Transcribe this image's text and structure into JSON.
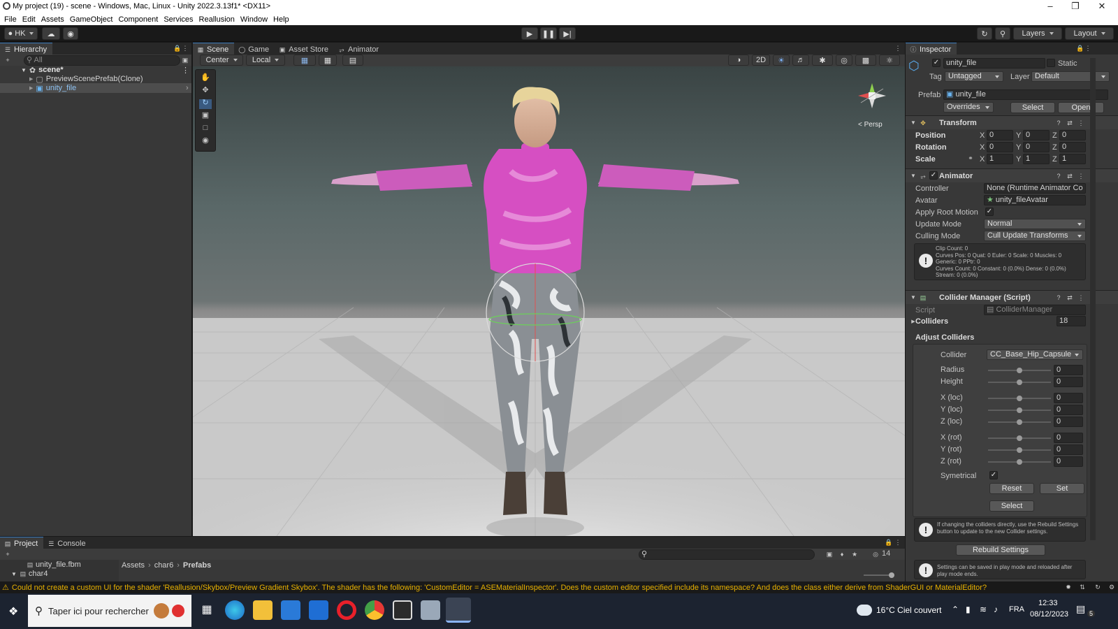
{
  "window": {
    "title": "My project (19) - scene - Windows, Mac, Linux - Unity 2022.3.13f1* <DX11>"
  },
  "menu": [
    "File",
    "Edit",
    "Assets",
    "GameObject",
    "Component",
    "Services",
    "Reallusion",
    "Window",
    "Help"
  ],
  "toolbar": {
    "account": "HK",
    "layers": "Layers",
    "layout": "Layout"
  },
  "hierarchy": {
    "tab": "Hierarchy",
    "search_placeholder": "All",
    "items": [
      {
        "label": "scene*"
      },
      {
        "label": "PreviewScenePrefab(Clone)"
      },
      {
        "label": "unity_file"
      }
    ]
  },
  "scene_view": {
    "tabs": [
      "Scene",
      "Game",
      "Asset Store",
      "Animator"
    ],
    "pivot": "Center",
    "space": "Local",
    "mode_2d": "2D",
    "projection": "< Persp"
  },
  "inspector": {
    "tab": "Inspector",
    "object_name": "unity_file",
    "static_label": "Static",
    "tag_label": "Tag",
    "tag_value": "Untagged",
    "layer_label": "Layer",
    "layer_value": "Default",
    "prefab_label": "Prefab",
    "prefab_value": "unity_file",
    "overrides": "Overrides",
    "select": "Select",
    "open": "Open",
    "transform": {
      "title": "Transform",
      "rows": [
        {
          "label": "Position",
          "x": "0",
          "y": "0",
          "z": "0"
        },
        {
          "label": "Rotation",
          "x": "0",
          "y": "0",
          "z": "0"
        },
        {
          "label": "Scale",
          "x": "1",
          "y": "1",
          "z": "1"
        }
      ]
    },
    "animator": {
      "title": "Animator",
      "controller_label": "Controller",
      "controller_value": "None (Runtime Animator Co",
      "avatar_label": "Avatar",
      "avatar_value": "unity_fileAvatar",
      "apply_root_motion": "Apply Root Motion",
      "update_mode_label": "Update Mode",
      "update_mode_value": "Normal",
      "culling_mode_label": "Culling Mode",
      "culling_mode_value": "Cull Update Transforms",
      "info": [
        "Clip Count: 0",
        "Curves Pos: 0 Quat: 0 Euler: 0 Scale: 0 Muscles: 0",
        "Generic: 0 PPtr: 0",
        "Curves Count: 0 Constant: 0 (0.0%) Dense: 0 (0.0%)",
        "Stream: 0 (0.0%)"
      ]
    },
    "collider_manager": {
      "title": "Collider Manager (Script)",
      "script_label": "Script",
      "script_value": "ColliderManager",
      "colliders_label": "Colliders",
      "colliders_value": "18",
      "adjust_label": "Adjust Colliders",
      "collider_label": "Collider",
      "collider_value": "CC_Base_Hip_Capsule",
      "sliders": [
        {
          "label": "Radius",
          "value": "0"
        },
        {
          "label": "Height",
          "value": "0"
        },
        {
          "label": "X (loc)",
          "value": "0"
        },
        {
          "label": "Y (loc)",
          "value": "0"
        },
        {
          "label": "Z (loc)",
          "value": "0"
        },
        {
          "label": "X (rot)",
          "value": "0"
        },
        {
          "label": "Y (rot)",
          "value": "0"
        },
        {
          "label": "Z (rot)",
          "value": "0"
        }
      ],
      "symetrical_label": "Symetrical",
      "reset": "Reset",
      "set": "Set",
      "select": "Select",
      "rebuild_help": "If changing the colliders directly, use the Rebuild Settings button to update to the new Collider settings.",
      "rebuild_button": "Rebuild Settings",
      "save_help": "Settings can be saved in play mode and reloaded after play mode ends."
    }
  },
  "project": {
    "tabs": [
      "Project",
      "Console"
    ],
    "tree": [
      "unity_file.fbm",
      "char4"
    ],
    "breadcrumb": [
      "Assets",
      "char6",
      "Prefabs"
    ],
    "hidden_count": "14"
  },
  "status": {
    "message": "Could not create a custom UI for the shader 'Reallusion/Skybox/Preview Gradient Skybox'. The shader has the following: 'CustomEditor = ASEMaterialInspector'. Does the custom editor specified include its namespace? And does the class either derive from ShaderGUI or MaterialEditor?"
  },
  "taskbar": {
    "search_placeholder": "Taper ici pour rechercher",
    "weather": "16°C  Ciel couvert",
    "language": "FRA",
    "time": "12:33",
    "date": "08/12/2023",
    "notifications": "5"
  },
  "colors": {
    "accent": "#3a79bb",
    "warning": "#e8b100",
    "shirt": "#d64fc2"
  }
}
